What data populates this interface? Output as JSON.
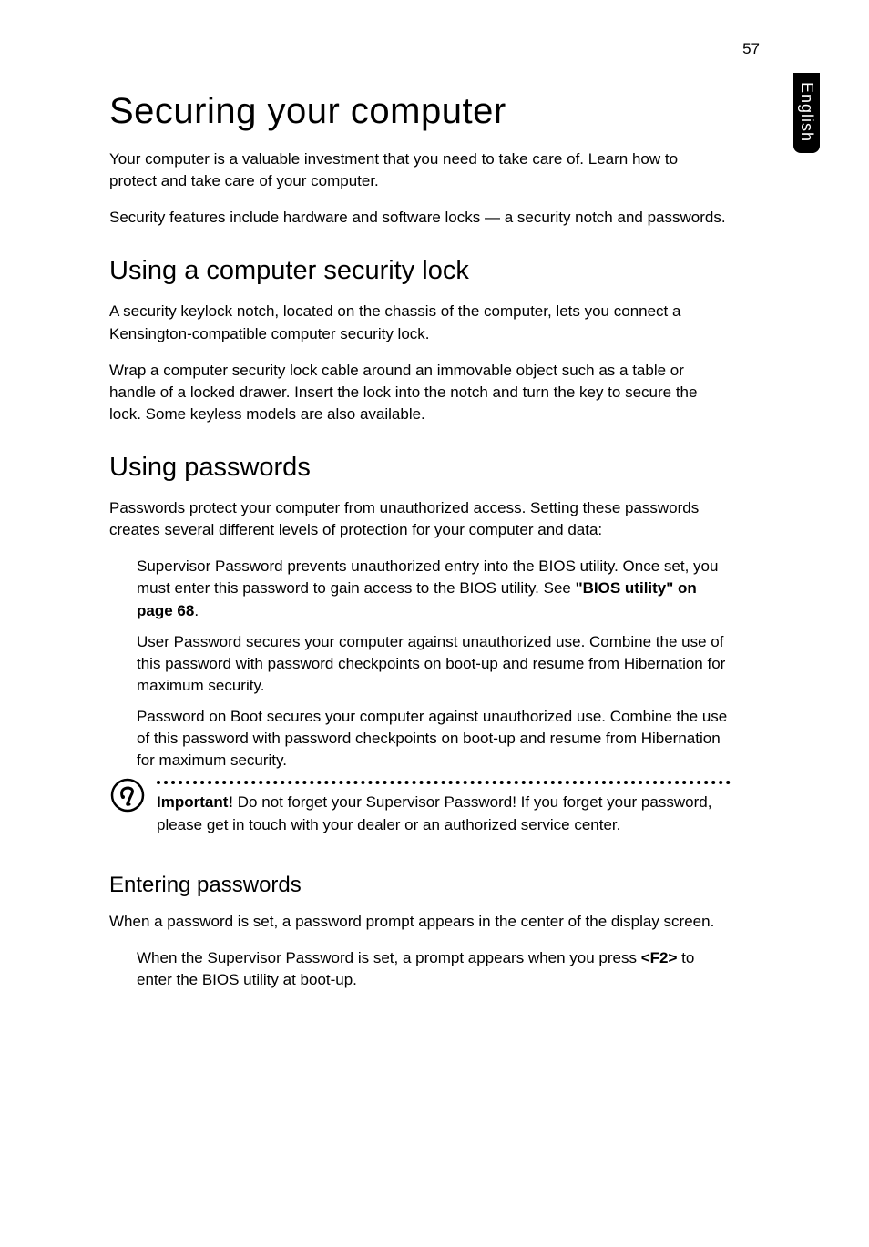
{
  "page_number": "57",
  "side_tab": "English",
  "h1": "Securing your computer",
  "p1": "Your computer is a valuable investment that you need to take care of. Learn how to protect and take care of your computer.",
  "p2": "Security features include hardware and software locks — a security notch and passwords.",
  "h2a": "Using a computer security lock",
  "p3": "A security keylock notch, located on the chassis of the computer, lets you connect a Kensington-compatible computer security lock.",
  "p4": "Wrap a computer security lock cable around an immovable object such as a table or handle of a locked drawer. Insert the lock into the notch and turn the key to secure the lock. Some keyless models are also available.",
  "h2b": "Using passwords",
  "p5": "Passwords protect your computer from unauthorized access. Setting these passwords creates several different levels of protection for your computer and data:",
  "li1_a": "Supervisor Password prevents unauthorized entry into the BIOS utility. Once set, you must enter this password to gain access to the BIOS utility. See ",
  "li1_bold": "\"BIOS utility\" on page 68",
  "li1_b": ".",
  "li2": "User Password secures your computer against unauthorized use. Combine the use of this password with password checkpoints on boot-up and resume from Hibernation for maximum security.",
  "li3": "Password on Boot secures your computer against unauthorized use. Combine the use of this password with password checkpoints on boot-up and resume from Hibernation for maximum security.",
  "note_bold": "Important! ",
  "note_text": "Do not forget your Supervisor Password! If you forget your password, please get in touch with your dealer or an authorized service center.",
  "h3": "Entering passwords",
  "p6": "When a password is set, a password prompt appears in the center of the display screen.",
  "li4_a": "When the Supervisor Password is set, a prompt appears when you press ",
  "li4_key": "<F2>",
  "li4_b": " to enter the BIOS utility at boot-up."
}
